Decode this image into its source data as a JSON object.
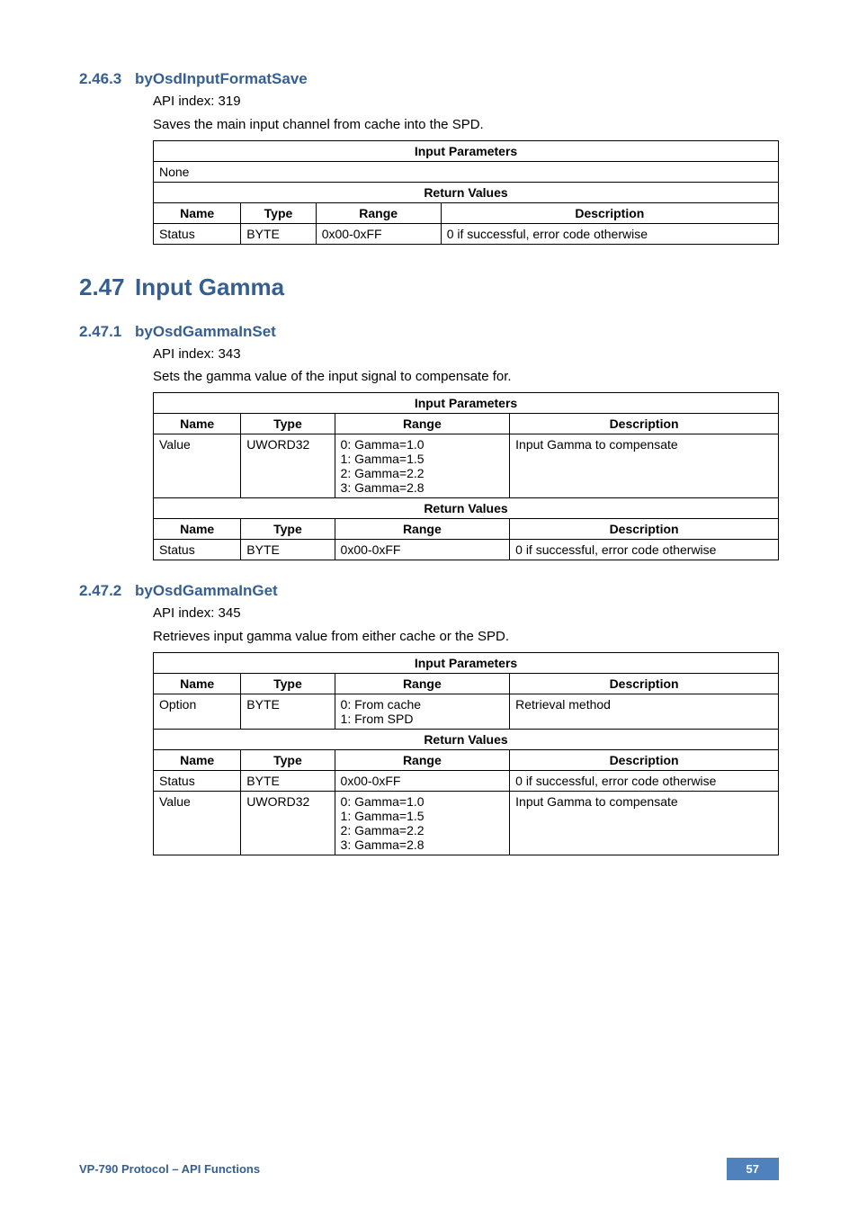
{
  "sections": {
    "s1": {
      "num": "2.46.3",
      "title": "byOsdInputFormatSave",
      "api_line": "API index: 319",
      "desc_line": "Saves the main input channel from cache into the SPD.",
      "table": {
        "input_hdr": "Input Parameters",
        "none": "None",
        "return_hdr": "Return Values",
        "cols": {
          "name": "Name",
          "type": "Type",
          "range": "Range",
          "desc": "Description"
        },
        "row": {
          "name": "Status",
          "type": "BYTE",
          "range": "0x00-0xFF",
          "desc": "0 if successful, error code otherwise"
        }
      }
    },
    "h2": {
      "num": "2.47",
      "title": "Input Gamma"
    },
    "s2": {
      "num": "2.47.1",
      "title": "byOsdGammaInSet",
      "api_line": "API index: 343",
      "desc_line": "Sets the gamma value of the input signal to compensate for.",
      "table": {
        "input_hdr": "Input Parameters",
        "cols": {
          "name": "Name",
          "type": "Type",
          "range": "Range",
          "desc": "Description"
        },
        "row1": {
          "name": "Value",
          "type": "UWORD32",
          "range0": "0: Gamma=1.0",
          "range1": "1: Gamma=1.5",
          "range2": "2: Gamma=2.2",
          "range3": "3: Gamma=2.8",
          "desc": "Input Gamma to compensate"
        },
        "return_hdr": "Return Values",
        "row2": {
          "name": "Status",
          "type": "BYTE",
          "range": "0x00-0xFF",
          "desc": "0 if successful, error code otherwise"
        }
      }
    },
    "s3": {
      "num": "2.47.2",
      "title": "byOsdGammaInGet",
      "api_line": "API index: 345",
      "desc_line": "Retrieves input gamma value from either cache or the SPD.",
      "table": {
        "input_hdr": "Input Parameters",
        "cols": {
          "name": "Name",
          "type": "Type",
          "range": "Range",
          "desc": "Description"
        },
        "row_in": {
          "name": "Option",
          "type": "BYTE",
          "range0": "0: From cache",
          "range1": "1: From SPD",
          "desc": "Retrieval method"
        },
        "return_hdr": "Return Values",
        "row_out1": {
          "name": "Status",
          "type": "BYTE",
          "range": "0x00-0xFF",
          "desc": "0 if successful, error code otherwise"
        },
        "row_out2": {
          "name": "Value",
          "type": "UWORD32",
          "range0": "0: Gamma=1.0",
          "range1": "1: Gamma=1.5",
          "range2": "2: Gamma=2.2",
          "range3": "3: Gamma=2.8",
          "desc": "Input Gamma to compensate"
        }
      }
    }
  },
  "footer": {
    "left": "VP-790 Protocol –  API Functions",
    "page": "57"
  }
}
